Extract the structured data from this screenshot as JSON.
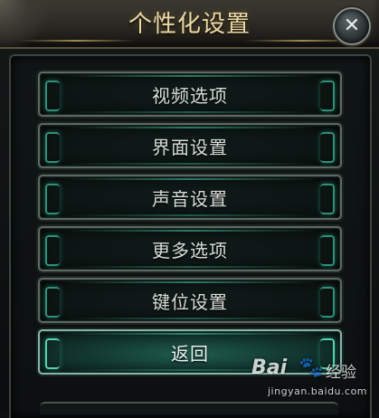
{
  "dialog": {
    "title": "个性化设置",
    "close_label": "✕"
  },
  "menu": {
    "items": [
      {
        "label": "视频选项",
        "active": false
      },
      {
        "label": "界面设置",
        "active": false
      },
      {
        "label": "声音设置",
        "active": false
      },
      {
        "label": "更多选项",
        "active": false
      },
      {
        "label": "键位设置",
        "active": false
      },
      {
        "label": "返回",
        "active": true
      }
    ]
  },
  "watermark": {
    "logo_text": "Bai",
    "paw": "🐾",
    "cn_text": "经验",
    "url": "jingyan.baidu.com"
  },
  "colors": {
    "title_gold": "#e9d9a6",
    "button_teal": "#2f8f78",
    "active_green": "#1e5c4f"
  }
}
